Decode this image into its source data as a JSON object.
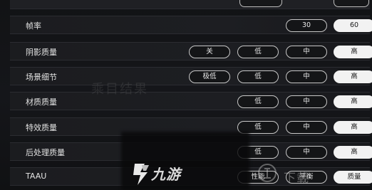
{
  "settings": [
    {
      "label": "帧率",
      "options": [
        "30",
        "60"
      ],
      "selected": "60"
    },
    {
      "label": "阴影质量",
      "options": [
        "关",
        "低",
        "中",
        "高"
      ],
      "selected": "高"
    },
    {
      "label": "场景细节",
      "options": [
        "极低",
        "低",
        "中",
        "高"
      ],
      "selected": "高"
    },
    {
      "label": "材质质量",
      "options": [
        "低",
        "中",
        "高"
      ],
      "selected": "高"
    },
    {
      "label": "特效质量",
      "options": [
        "低",
        "中",
        "高"
      ],
      "selected": "高"
    },
    {
      "label": "后处理质量",
      "options": [
        "低",
        "中",
        "高"
      ],
      "selected": "高"
    },
    {
      "label": "TAAU",
      "options": [
        "性能",
        "平衡",
        "质量"
      ],
      "selected": "质量"
    }
  ],
  "watermarks": {
    "ghost_text": "乘目结果",
    "logo_text": "九游",
    "site_text": "下载"
  },
  "colors": {
    "background": "#0e0f11",
    "row": "#1d1e22",
    "selected_fill": "#f2f2f2",
    "pill_border": "#c8c8c8"
  }
}
